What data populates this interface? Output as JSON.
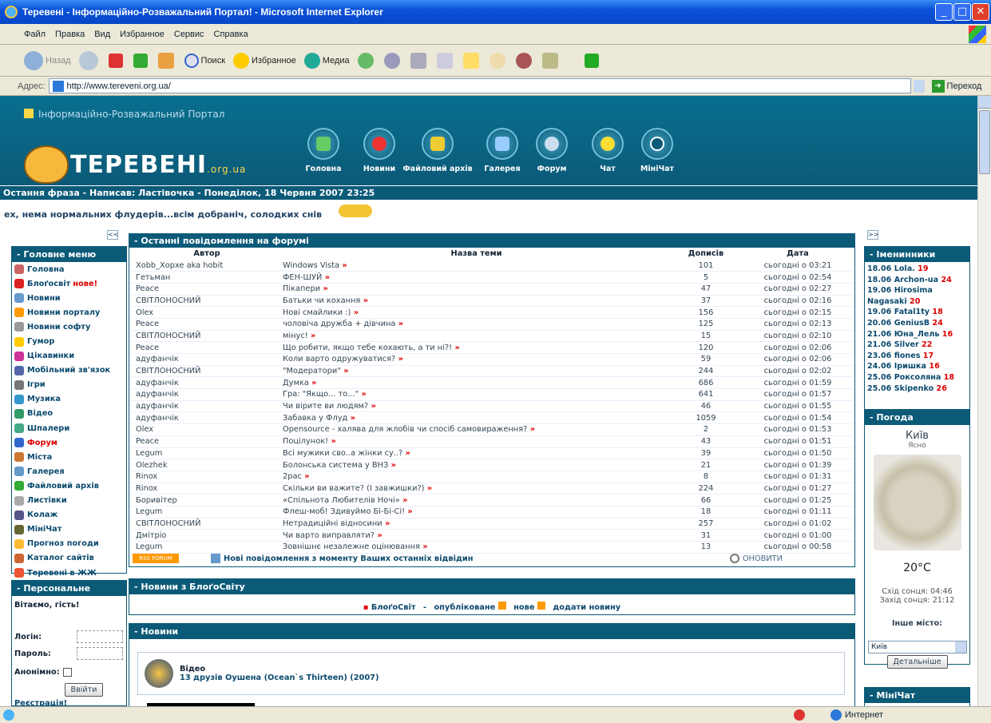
{
  "window": {
    "title": "Теревені - Інформаційно-Розважальний Портал! - Microsoft Internet Explorer"
  },
  "menubar": [
    "Файл",
    "Правка",
    "Вид",
    "Избранное",
    "Сервис",
    "Справка"
  ],
  "toolbar": {
    "back": "Назад",
    "search": "Поиск",
    "favorites": "Избранное",
    "media": "Медиа"
  },
  "address": {
    "label": "Адрес:",
    "url": "http://www.tereveni.org.ua/",
    "go": "Переход"
  },
  "status": {
    "zone": "Интернет"
  },
  "site": {
    "tagline": "Інформаційно-Розважальний Портал",
    "logo": "ТЕРЕВЕНІ",
    "logo_domain": ".org.ua",
    "nav": [
      "Головна",
      "Новини",
      "Файловий архів",
      "Галерея",
      "Форум",
      "Чат",
      "МініЧат"
    ],
    "last_phrase_bar": "Остання фраза - Написав: Ластівочка - Понеділок, 18 Червня 2007 23:25",
    "last_phrase": "ех, нема нормальних флудерів...всім добраніч, солодких снів"
  },
  "left_menu": {
    "title": "- Головне меню",
    "items": [
      {
        "label": "Головна",
        "extra": ""
      },
      {
        "label": "Блоґосвіт",
        "extra": "нове!"
      },
      {
        "label": "Новини",
        "extra": ""
      },
      {
        "label": "Новини порталу",
        "extra": ""
      },
      {
        "label": "Новини софту",
        "extra": ""
      },
      {
        "label": "Гумор",
        "extra": ""
      },
      {
        "label": "Цікавинки",
        "extra": ""
      },
      {
        "label": "Мобільний зв'язок",
        "extra": ""
      },
      {
        "label": "Ігри",
        "extra": ""
      },
      {
        "label": "Музика",
        "extra": ""
      },
      {
        "label": "Відео",
        "extra": ""
      },
      {
        "label": "Шпалери",
        "extra": ""
      },
      {
        "label": "Форум",
        "extra": ""
      },
      {
        "label": "Міста",
        "extra": ""
      },
      {
        "label": "Галерея",
        "extra": ""
      },
      {
        "label": "Файловий архів",
        "extra": ""
      },
      {
        "label": "Листівки",
        "extra": ""
      },
      {
        "label": "Колаж",
        "extra": ""
      },
      {
        "label": "МініЧат",
        "extra": ""
      },
      {
        "label": "Прогноз погоди",
        "extra": ""
      },
      {
        "label": "Каталог сайтів",
        "extra": ""
      },
      {
        "label": "Теревені в ЖЖ",
        "extra": ""
      }
    ]
  },
  "personal": {
    "title": "- Персональне",
    "greeting": "Вітаємо, гість!",
    "login_label": "Логін:",
    "password_label": "Пароль:",
    "anon_label": "Анонімно:",
    "submit": "Ввійти",
    "register": "Реєстрація!"
  },
  "forum": {
    "title": "- Останні повідомлення на форумі",
    "columns": [
      "Автор",
      "Назва теми",
      "Дописів",
      "Дата"
    ],
    "rows": [
      [
        "Xobb_Xopxe aka hobit",
        "Windows Vista",
        "101",
        "сьогодні о 03:21"
      ],
      [
        "Гетьман",
        "ФЕН-ШУЙ",
        "5",
        "сьогодні о 02:54"
      ],
      [
        "Peace",
        "Пікапери",
        "47",
        "сьогодні о 02:27"
      ],
      [
        "СВІТЛОНОСНИЙ",
        "Батьки чи кохання",
        "37",
        "сьогодні о 02:16"
      ],
      [
        "Olex",
        "Нові смайлики :)",
        "156",
        "сьогодні о 02:15"
      ],
      [
        "Peace",
        "чоловіча дружба + дівчина",
        "125",
        "сьогодні о 02:13"
      ],
      [
        "СВІТЛОНОСНИЙ",
        "мінус!",
        "15",
        "сьогодні о 02:10"
      ],
      [
        "Peace",
        "Що робити, якщо тебе кохають, а ти ні?!",
        "120",
        "сьогодні о 02:06"
      ],
      [
        "адуфанчік",
        "Коли варто одружуватися?",
        "59",
        "сьогодні о 02:06"
      ],
      [
        "СВІТЛОНОСНИЙ",
        "\"Модератори\"",
        "244",
        "сьогодні о 02:02"
      ],
      [
        "адуфанчік",
        "Думка",
        "686",
        "сьогодні о 01:59"
      ],
      [
        "адуфанчік",
        "Гра: \"Якщо... то...\"",
        "641",
        "сьогодні о 01:57"
      ],
      [
        "адуфанчік",
        "Чи вірите ви людям?",
        "46",
        "сьогодні о 01:55"
      ],
      [
        "адуфанчік",
        "Забавка у Флуд",
        "1059",
        "сьогодні о 01:54"
      ],
      [
        "Olex",
        "Opensource - халява для жлобів чи спосіб самовираження?",
        "2",
        "сьогодні о 01:53"
      ],
      [
        "Peace",
        "Поцілунок!",
        "43",
        "сьогодні о 01:51"
      ],
      [
        "Legum",
        "Всі мужики сво..а жінки су..?",
        "39",
        "сьогодні о 01:50"
      ],
      [
        "Olezhek",
        "Болонська система у ВНЗ",
        "21",
        "сьогодні о 01:39"
      ],
      [
        "Rinox",
        "2рас",
        "8",
        "сьогодні о 01:31"
      ],
      [
        "Rinox",
        "Скільки ви важите? (І завжишки?)",
        "224",
        "сьогодні о 01:27"
      ],
      [
        "Боривітер",
        "«Спільнота Любителів Ночі»",
        "66",
        "сьогодні о 01:25"
      ],
      [
        "Legum",
        "Флеш-моб! Здивуймо Бі-Бі-Сі!",
        "18",
        "сьогодні о 01:11"
      ],
      [
        "СВІТЛОНОСНИЙ",
        "Нетрадиційні відносини",
        "257",
        "сьогодні о 01:02"
      ],
      [
        "Дмітріо",
        "Чи варто виправляти?",
        "31",
        "сьогодні о 01:00"
      ],
      [
        "Legum",
        "Зовнішнє незалежне оцінювання",
        "13",
        "сьогодні о 00:58"
      ]
    ],
    "rss_label": "RSS FORUM",
    "new_msgs": "Нові повідомлення з моменту Ваших останніх відвідин",
    "refresh": "ОНОВИТИ"
  },
  "blog": {
    "title": "- Новини з БлоґоСвіту",
    "link": "БлоґоСвіт",
    "sep": "-",
    "published": "опубліковане",
    "new": "нове",
    "add": "додати новину"
  },
  "news": {
    "title": "- Новини",
    "category": "Відео",
    "headline": "13 друзів Оушена (Ocean`s Thirteen) (2007)"
  },
  "birthdays": {
    "title": "- Іменинники",
    "items": [
      {
        "date": "18.06",
        "name": "Lola.",
        "age": "19"
      },
      {
        "date": "18.06",
        "name": "Archon-ua",
        "age": "24"
      },
      {
        "date": "19.06",
        "name": "Hirosima Nagasaki",
        "age": "20"
      },
      {
        "date": "19.06",
        "name": "Fatal1ty",
        "age": "18"
      },
      {
        "date": "20.06",
        "name": "GeniusB",
        "age": "24"
      },
      {
        "date": "21.06",
        "name": "Юна_Лель",
        "age": "16"
      },
      {
        "date": "21.06",
        "name": "Silver",
        "age": "22"
      },
      {
        "date": "23.06",
        "name": "fiones",
        "age": "17"
      },
      {
        "date": "24.06",
        "name": "Іришка",
        "age": "16"
      },
      {
        "date": "25.06",
        "name": "Роксоляна",
        "age": "18"
      },
      {
        "date": "25.06",
        "name": "Skipenko",
        "age": "26"
      }
    ]
  },
  "weather": {
    "title": "- Погода",
    "city": "Київ",
    "condition": "Ясно",
    "temp": "20°C",
    "sunrise": "Схід сонця: 04:46",
    "sunset": "Захід сонця: 21:12",
    "other_city": "Інше місто:",
    "selected_city": "Київ",
    "details_btn": "Детальніше"
  },
  "minichat": {
    "title": "- МініЧат"
  }
}
